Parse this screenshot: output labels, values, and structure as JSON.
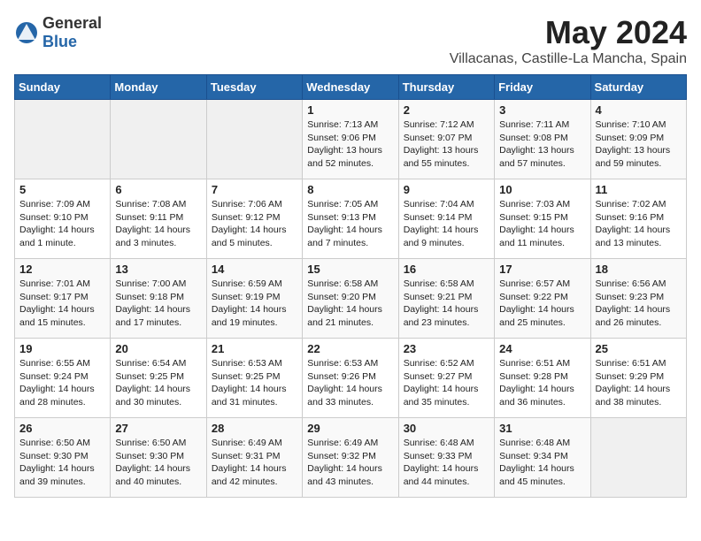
{
  "logo": {
    "text_general": "General",
    "text_blue": "Blue"
  },
  "title": {
    "month_year": "May 2024",
    "location": "Villacanas, Castille-La Mancha, Spain"
  },
  "days_of_week": [
    "Sunday",
    "Monday",
    "Tuesday",
    "Wednesday",
    "Thursday",
    "Friday",
    "Saturday"
  ],
  "weeks": [
    [
      {
        "day": "",
        "info": ""
      },
      {
        "day": "",
        "info": ""
      },
      {
        "day": "",
        "info": ""
      },
      {
        "day": "1",
        "info": "Sunrise: 7:13 AM\nSunset: 9:06 PM\nDaylight: 13 hours and 52 minutes."
      },
      {
        "day": "2",
        "info": "Sunrise: 7:12 AM\nSunset: 9:07 PM\nDaylight: 13 hours and 55 minutes."
      },
      {
        "day": "3",
        "info": "Sunrise: 7:11 AM\nSunset: 9:08 PM\nDaylight: 13 hours and 57 minutes."
      },
      {
        "day": "4",
        "info": "Sunrise: 7:10 AM\nSunset: 9:09 PM\nDaylight: 13 hours and 59 minutes."
      }
    ],
    [
      {
        "day": "5",
        "info": "Sunrise: 7:09 AM\nSunset: 9:10 PM\nDaylight: 14 hours and 1 minute."
      },
      {
        "day": "6",
        "info": "Sunrise: 7:08 AM\nSunset: 9:11 PM\nDaylight: 14 hours and 3 minutes."
      },
      {
        "day": "7",
        "info": "Sunrise: 7:06 AM\nSunset: 9:12 PM\nDaylight: 14 hours and 5 minutes."
      },
      {
        "day": "8",
        "info": "Sunrise: 7:05 AM\nSunset: 9:13 PM\nDaylight: 14 hours and 7 minutes."
      },
      {
        "day": "9",
        "info": "Sunrise: 7:04 AM\nSunset: 9:14 PM\nDaylight: 14 hours and 9 minutes."
      },
      {
        "day": "10",
        "info": "Sunrise: 7:03 AM\nSunset: 9:15 PM\nDaylight: 14 hours and 11 minutes."
      },
      {
        "day": "11",
        "info": "Sunrise: 7:02 AM\nSunset: 9:16 PM\nDaylight: 14 hours and 13 minutes."
      }
    ],
    [
      {
        "day": "12",
        "info": "Sunrise: 7:01 AM\nSunset: 9:17 PM\nDaylight: 14 hours and 15 minutes."
      },
      {
        "day": "13",
        "info": "Sunrise: 7:00 AM\nSunset: 9:18 PM\nDaylight: 14 hours and 17 minutes."
      },
      {
        "day": "14",
        "info": "Sunrise: 6:59 AM\nSunset: 9:19 PM\nDaylight: 14 hours and 19 minutes."
      },
      {
        "day": "15",
        "info": "Sunrise: 6:58 AM\nSunset: 9:20 PM\nDaylight: 14 hours and 21 minutes."
      },
      {
        "day": "16",
        "info": "Sunrise: 6:58 AM\nSunset: 9:21 PM\nDaylight: 14 hours and 23 minutes."
      },
      {
        "day": "17",
        "info": "Sunrise: 6:57 AM\nSunset: 9:22 PM\nDaylight: 14 hours and 25 minutes."
      },
      {
        "day": "18",
        "info": "Sunrise: 6:56 AM\nSunset: 9:23 PM\nDaylight: 14 hours and 26 minutes."
      }
    ],
    [
      {
        "day": "19",
        "info": "Sunrise: 6:55 AM\nSunset: 9:24 PM\nDaylight: 14 hours and 28 minutes."
      },
      {
        "day": "20",
        "info": "Sunrise: 6:54 AM\nSunset: 9:25 PM\nDaylight: 14 hours and 30 minutes."
      },
      {
        "day": "21",
        "info": "Sunrise: 6:53 AM\nSunset: 9:25 PM\nDaylight: 14 hours and 31 minutes."
      },
      {
        "day": "22",
        "info": "Sunrise: 6:53 AM\nSunset: 9:26 PM\nDaylight: 14 hours and 33 minutes."
      },
      {
        "day": "23",
        "info": "Sunrise: 6:52 AM\nSunset: 9:27 PM\nDaylight: 14 hours and 35 minutes."
      },
      {
        "day": "24",
        "info": "Sunrise: 6:51 AM\nSunset: 9:28 PM\nDaylight: 14 hours and 36 minutes."
      },
      {
        "day": "25",
        "info": "Sunrise: 6:51 AM\nSunset: 9:29 PM\nDaylight: 14 hours and 38 minutes."
      }
    ],
    [
      {
        "day": "26",
        "info": "Sunrise: 6:50 AM\nSunset: 9:30 PM\nDaylight: 14 hours and 39 minutes."
      },
      {
        "day": "27",
        "info": "Sunrise: 6:50 AM\nSunset: 9:30 PM\nDaylight: 14 hours and 40 minutes."
      },
      {
        "day": "28",
        "info": "Sunrise: 6:49 AM\nSunset: 9:31 PM\nDaylight: 14 hours and 42 minutes."
      },
      {
        "day": "29",
        "info": "Sunrise: 6:49 AM\nSunset: 9:32 PM\nDaylight: 14 hours and 43 minutes."
      },
      {
        "day": "30",
        "info": "Sunrise: 6:48 AM\nSunset: 9:33 PM\nDaylight: 14 hours and 44 minutes."
      },
      {
        "day": "31",
        "info": "Sunrise: 6:48 AM\nSunset: 9:34 PM\nDaylight: 14 hours and 45 minutes."
      },
      {
        "day": "",
        "info": ""
      }
    ]
  ]
}
